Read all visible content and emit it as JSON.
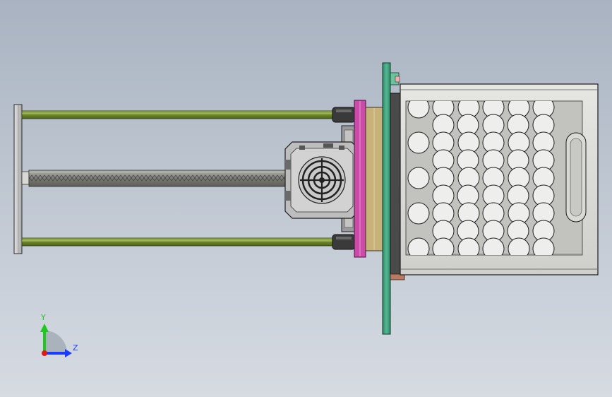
{
  "viewport": {
    "background_top": "#a9b3c1",
    "background_bottom": "#d6dbe2"
  },
  "triad": {
    "y_label": "Y",
    "z_label": "Z",
    "y_color": "#1ec81e",
    "z_color": "#1a3cff",
    "x_color": "#e01818"
  },
  "colors": {
    "guide_rod": "#7f9a3a",
    "lead_screw": "#8a8a86",
    "green_plate": "#3f9f7f",
    "magenta_flange": "#cc4aa8",
    "tan_block": "#c8b27a",
    "hopper_body": "#d9d9d6",
    "motor_housing": "#bdbdbd",
    "end_plate": "#cfcfcf"
  },
  "components": [
    "end-plate",
    "upper-guide-rod",
    "lower-guide-rod",
    "lead-screw",
    "stepper-motor",
    "magenta-flange",
    "tan-mount-block",
    "green-mount-plate",
    "perforated-hopper"
  ]
}
